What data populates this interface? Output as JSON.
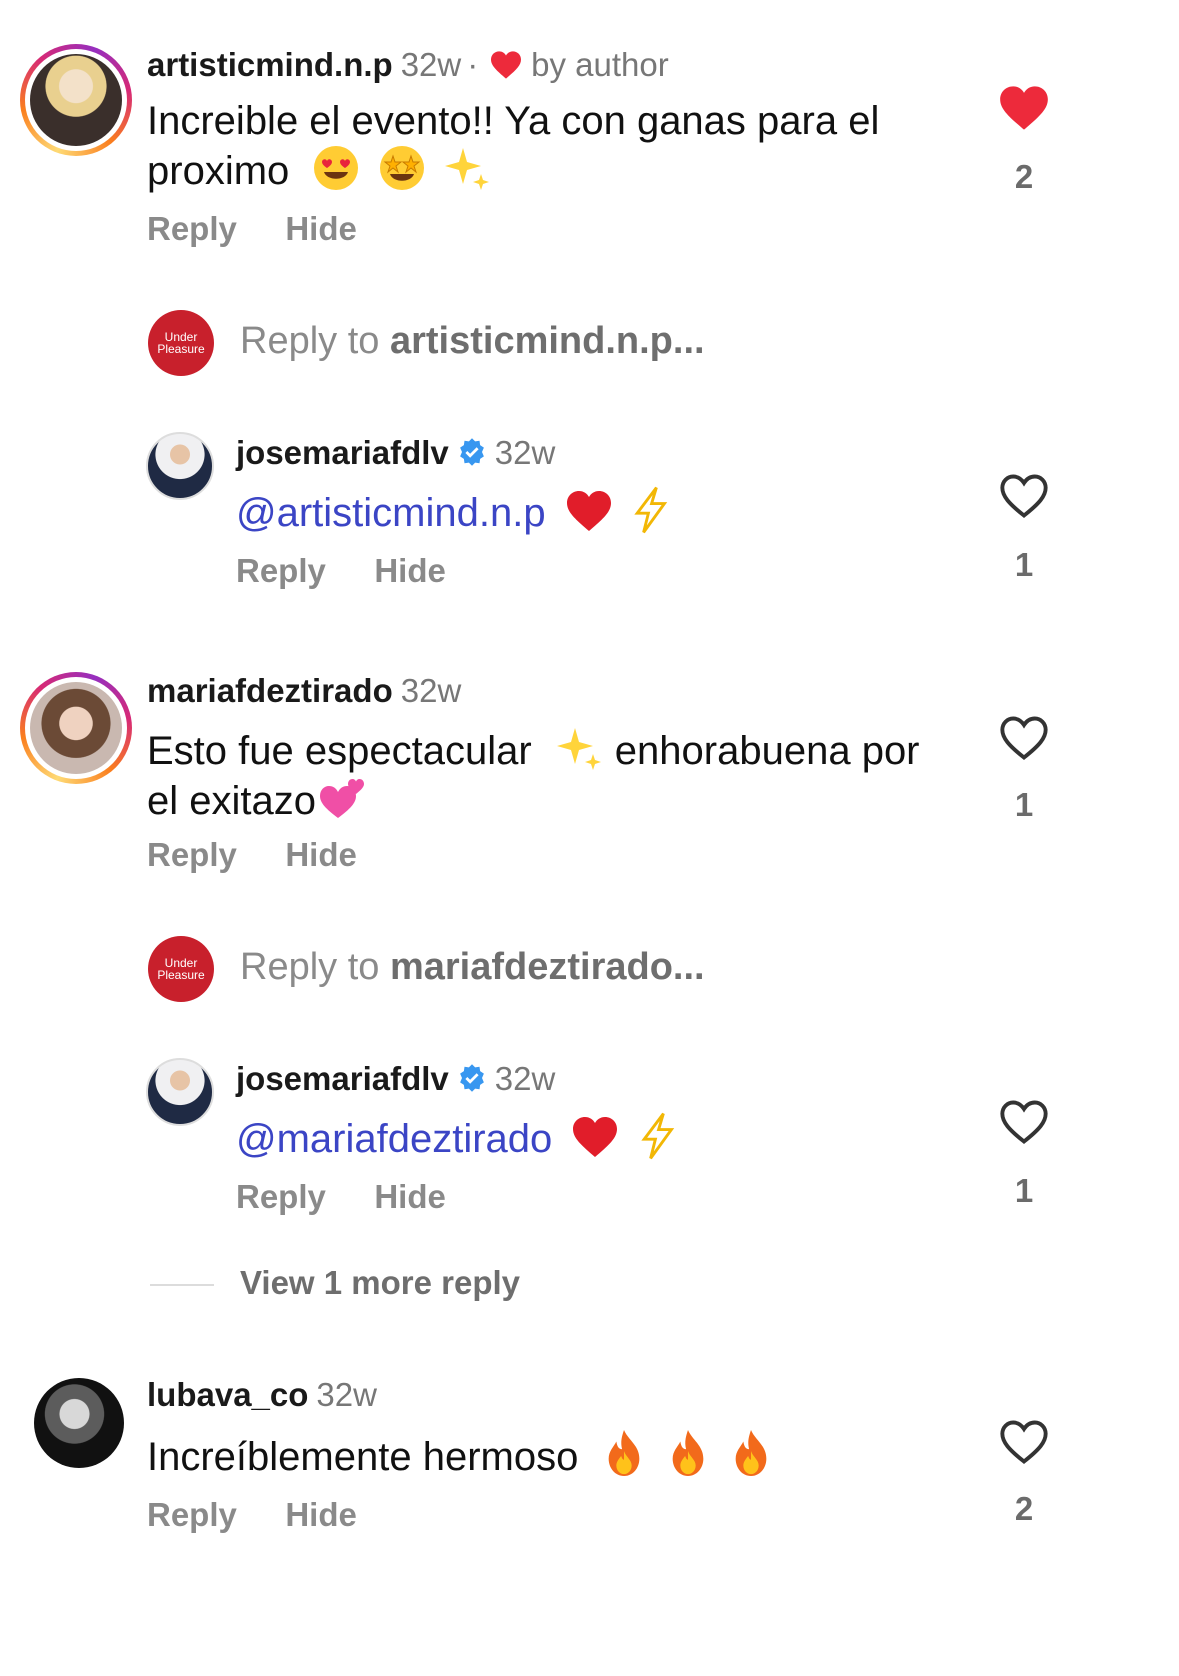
{
  "comments": [
    {
      "username": "artisticmind.n.p",
      "time": "32w",
      "author_badge": "by author",
      "text_main": "Increible el evento!! Ya con ganas para el",
      "text_line2": "proximo",
      "reply_label": "Reply",
      "hide_label": "Hide",
      "likes": "2",
      "liked": true,
      "reply_prompt_prefix": "Reply to ",
      "reply_prompt_user": "artisticmind.n.p...",
      "logo_line1": "Under",
      "logo_line2": "Pleasure"
    },
    {
      "username": "josemariafdlv",
      "time": "32w",
      "mention": "@artisticmind.n.p",
      "reply_label": "Reply",
      "hide_label": "Hide",
      "likes": "1"
    },
    {
      "username": "mariafdeztirado",
      "time": "32w",
      "text_main": "Esto fue espectacular",
      "text_after": "enhorabuena por",
      "text_line2": "el exitazo",
      "reply_label": "Reply",
      "hide_label": "Hide",
      "likes": "1",
      "reply_prompt_prefix": "Reply to ",
      "reply_prompt_user": "mariafdeztirado...",
      "logo_line1": "Under",
      "logo_line2": "Pleasure"
    },
    {
      "username": "josemariafdlv",
      "time": "32w",
      "mention": "@mariafdeztirado",
      "reply_label": "Reply",
      "hide_label": "Hide",
      "likes": "1"
    },
    {
      "username": "lubava_co",
      "time": "32w",
      "text_main": "Increíblemente hermoso",
      "reply_label": "Reply",
      "hide_label": "Hide",
      "likes": "2"
    }
  ],
  "view_more": "View 1 more reply",
  "colors": {
    "like_red": "#ed2a3b",
    "mention_blue": "#3b45c5",
    "verified_blue": "#3897f0"
  },
  "icons": [
    "heart-icon",
    "verified-badge-icon",
    "emoji"
  ]
}
